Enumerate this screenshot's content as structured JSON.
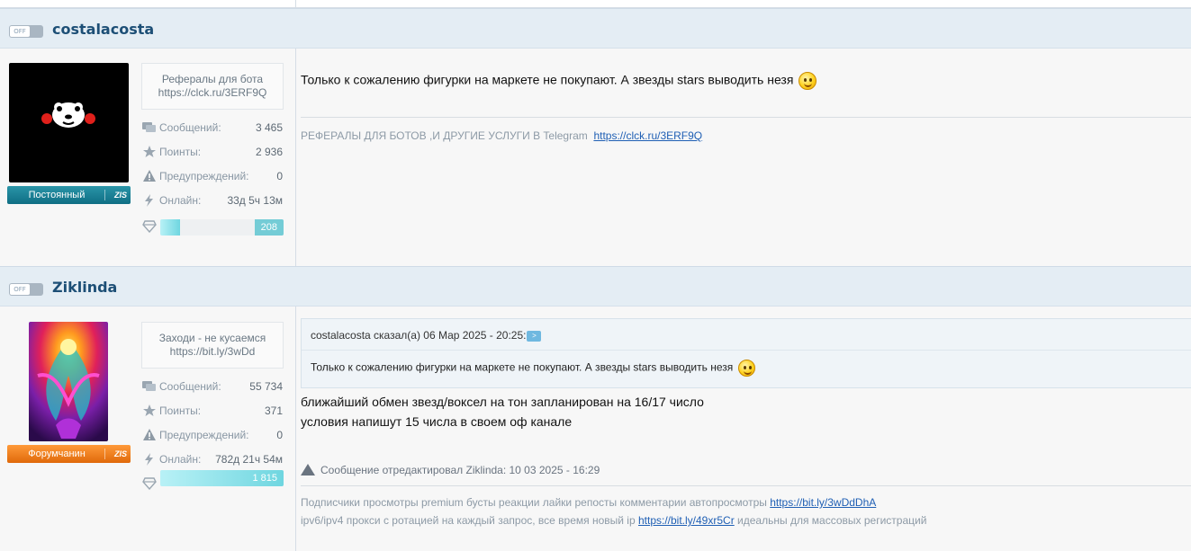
{
  "posts": [
    {
      "toggle_label": "OFF",
      "username": "costalacosta",
      "rank": "Постоянный",
      "rank_badge": "ZIS",
      "signature_box": {
        "line1": "Рефералы для бота",
        "line2": "https://clck.ru/3ERF9Q"
      },
      "stats": [
        {
          "label": "Сообщений:",
          "value": "3 465",
          "icon": "comments-icon"
        },
        {
          "label": "Поинты:",
          "value": "2 936",
          "icon": "star-icon"
        },
        {
          "label": "Предупреждений:",
          "value": "0",
          "icon": "warning-icon"
        },
        {
          "label": "Онлайн:",
          "value": "33д 5ч 13м",
          "icon": "lightning-icon"
        }
      ],
      "gems": {
        "value": "208",
        "fill_fraction": 0.16
      },
      "message": "Только к сожалению фигурки на маркете не покупают. А звезды stars выводить незя",
      "signature": {
        "text": "РЕФЕРАЛЫ ДЛЯ БОТОВ ,И ДРУГИЕ УСЛУГИ В Telegram",
        "link": "https://clck.ru/3ERF9Q"
      }
    },
    {
      "toggle_label": "OFF",
      "username": "Ziklinda",
      "rank": "Форумчанин",
      "rank_badge": "ZIS",
      "signature_box": {
        "line1": "Заходи - не кусаемся",
        "line2": "https://bit.ly/3wDd"
      },
      "stats": [
        {
          "label": "Сообщений:",
          "value": "55 734",
          "icon": "comments-icon"
        },
        {
          "label": "Поинты:",
          "value": "371",
          "icon": "star-icon"
        },
        {
          "label": "Предупреждений:",
          "value": "0",
          "icon": "warning-icon"
        },
        {
          "label": "Онлайн:",
          "value": "782д 21ч 54м",
          "icon": "lightning-icon"
        }
      ],
      "gems": {
        "value": "1 815",
        "fill_fraction": 1.0
      },
      "quote": {
        "header": "costalacosta сказал(а) 06 Мар 2025 - 20:25:",
        "arrow": ">",
        "text": "Только к сожалению фигурки на маркете не покупают. А звезды stars выводить незя"
      },
      "message_lines": [
        "ближайший обмен звезд/воксел на тон запланирован на 16/17 число",
        "условия напишут 15 числа в своем оф канале"
      ],
      "edit_note": "Сообщение отредактировал Ziklinda: 10 03 2025 - 16:29",
      "signature": {
        "line1_text": "Подписчики просмотры premium бусты реакции лайки репосты комментарии автопросмотры",
        "line1_link": "https://bit.ly/3wDdDhA",
        "line2_text": "ipv6/ipv4 прокси с ротацией на каждый запрос, все время новый ip",
        "line2_link": "https://bit.ly/49xr5Cr",
        "line2_tail": "идеальны для массовых регистраций"
      }
    }
  ],
  "colors": {
    "accent": "#1d4f76",
    "link": "#1f5fb4",
    "rank_teal": "#0f6e84",
    "rank_orange": "#e0690a",
    "gem": "#74ccd6"
  }
}
